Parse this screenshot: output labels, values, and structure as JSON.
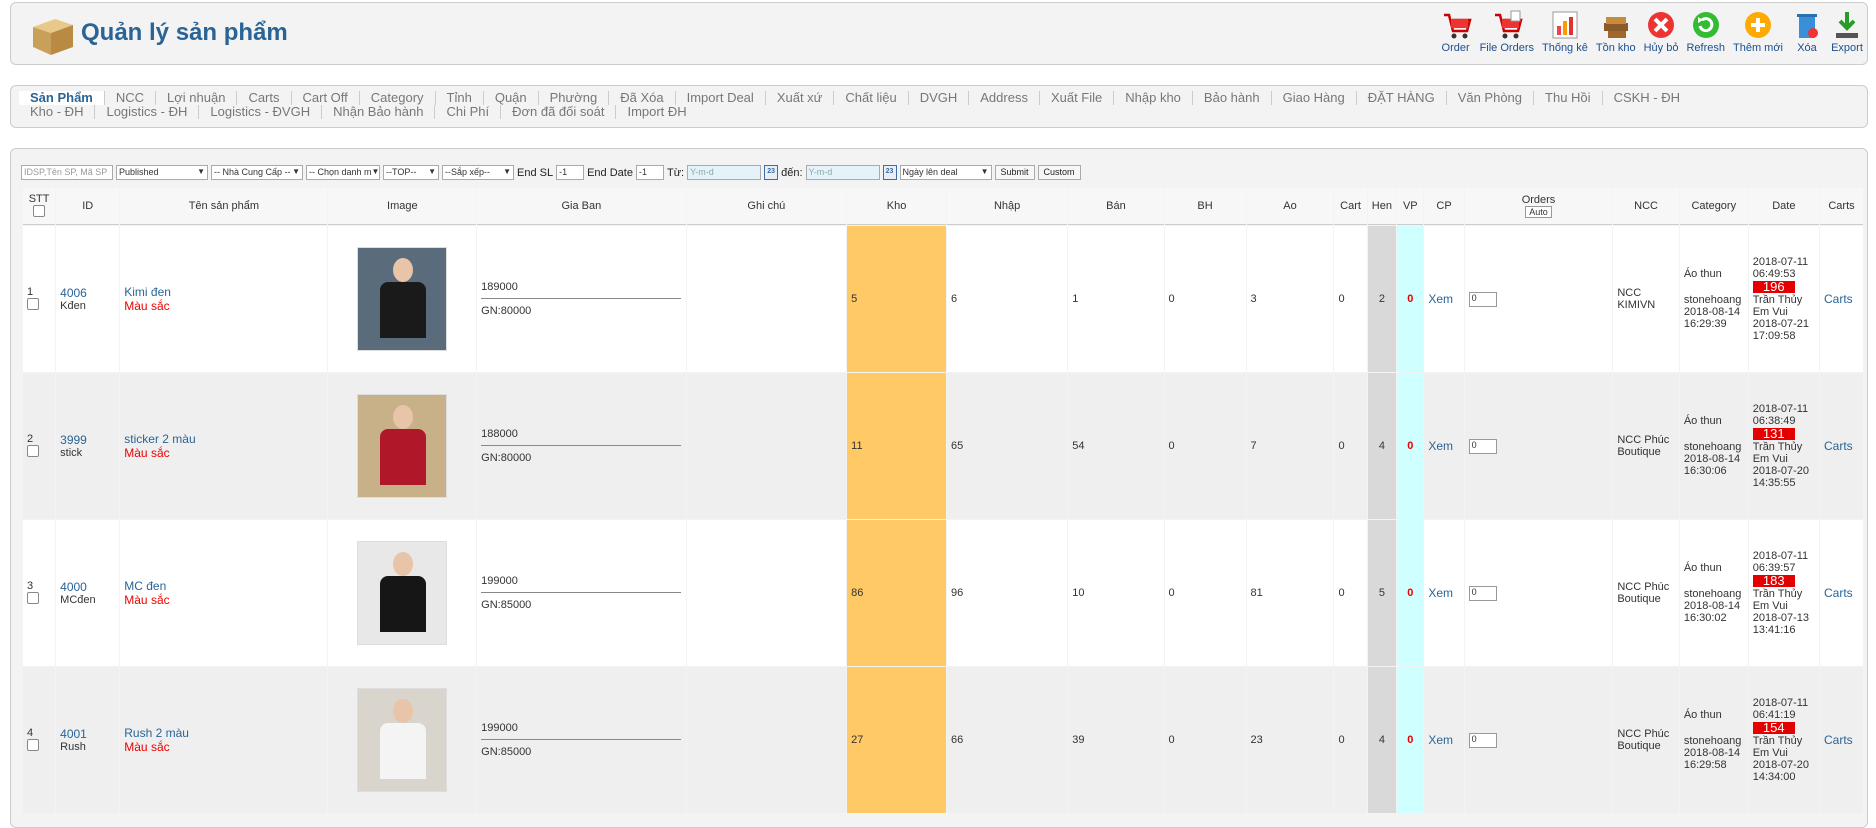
{
  "header": {
    "title": "Quản lý sản phẩm"
  },
  "toolbar": [
    {
      "label": "Order",
      "icon": "cart-icon"
    },
    {
      "label": "File Orders",
      "icon": "cart-file-icon"
    },
    {
      "label": "Thống kê",
      "icon": "chart-icon"
    },
    {
      "label": "Tồn kho",
      "icon": "boxes-icon"
    },
    {
      "label": "Hủy bỏ",
      "icon": "cancel-icon"
    },
    {
      "label": "Refresh",
      "icon": "refresh-icon"
    },
    {
      "label": "Thêm mới",
      "icon": "add-icon"
    },
    {
      "label": "Xóa",
      "icon": "trash-icon"
    },
    {
      "label": "Export",
      "icon": "export-icon"
    }
  ],
  "nav": {
    "row1": [
      "Sản Phẩm",
      "NCC",
      "Lợi nhuận",
      "Carts",
      "Cart Off",
      "Category",
      "Tỉnh",
      "Quận",
      "Phường",
      "Đã Xóa",
      "Import Deal",
      "Xuất xứ",
      "Chất liệu",
      "DVGH",
      "Address",
      "Xuất File",
      "Nhập kho",
      "Bảo hành",
      "Giao Hàng",
      "ĐẶT HÀNG",
      "Văn Phòng",
      "Thu Hồi",
      "CSKH - ĐH"
    ],
    "row2": [
      "Kho - ĐH",
      "Logistics - ĐH",
      "Logistics - ĐVGH",
      "Nhận Bảo hành",
      "Chi Phí",
      "Đơn đã đối soát",
      "Import ĐH"
    ],
    "active": "Sản Phẩm"
  },
  "filters": {
    "search_placeholder": "IDSP,Tên SP, Mã SP",
    "status": "Published",
    "supplier": "-- Nhà Cung Cấp --",
    "category": "-- Chọn danh m",
    "top": "--TOP--",
    "sort": "--Sắp xếp--",
    "end_sl_label": "End SL",
    "end_sl_value": "-1",
    "end_date_label": "End Date",
    "end_date_value": "-1",
    "from_label": "Từ:",
    "from_placeholder": "Y-m-d",
    "to_label": "đến:",
    "to_placeholder": "Y-m-d",
    "calendar_label": "23",
    "date_type": "Ngày lên deal",
    "submit": "Submit",
    "custom": "Custom"
  },
  "columns": [
    "STT",
    "ID",
    "Tên sản phẩm",
    "Image",
    "Gia Ban",
    "Ghi chú",
    "Kho",
    "Nhập",
    "Bán",
    "BH",
    "Ao",
    "Cart",
    "Hen",
    "VP",
    "CP",
    "Orders",
    "NCC",
    "Category",
    "Date",
    "Carts"
  ],
  "orders_auto": "Auto",
  "rows": [
    {
      "stt": "1",
      "id": "4006",
      "code": "Kđen",
      "name": "Kimi đen",
      "color": "Màu sắc",
      "price": "189000",
      "gn": "GN:80000",
      "kho": "5",
      "nhap": "6",
      "ban": "1",
      "bh": "0",
      "ao": "3",
      "cart": "0",
      "hen": "2",
      "vp": "0",
      "cp": "Xem",
      "orders": "0",
      "ncc": "NCC KIMIVN",
      "cat": "Áo thun",
      "user": "stonehoang",
      "updated": "2018-08-14 16:29:39",
      "date1": "2018-07-11 06:49:53",
      "badge": "196",
      "person": "Trần Thủy Em Vui",
      "date2": "2018-07-21 17:09:58",
      "carts": "Carts",
      "img_bg": "#5a6b7c",
      "img_fg": "#1a1a1a"
    },
    {
      "stt": "2",
      "id": "3999",
      "code": "stick",
      "name": "sticker 2 màu",
      "color": "Màu sắc",
      "price": "188000",
      "gn": "GN:80000",
      "kho": "11",
      "nhap": "65",
      "ban": "54",
      "bh": "0",
      "ao": "7",
      "cart": "0",
      "hen": "4",
      "vp": "0",
      "cp": "Xem",
      "orders": "0",
      "ncc": "NCC Phúc Boutique",
      "cat": "Áo thun",
      "user": "stonehoang",
      "updated": "2018-08-14 16:30:06",
      "date1": "2018-07-11 06:38:49",
      "badge": "131",
      "person": "Trần Thủy Em Vui",
      "date2": "2018-07-20 14:35:55",
      "carts": "Carts",
      "img_bg": "#c8b089",
      "img_fg": "#b0182a"
    },
    {
      "stt": "3",
      "id": "4000",
      "code": "MCđen",
      "name": "MC đen",
      "color": "Màu sắc",
      "price": "199000",
      "gn": "GN:85000",
      "kho": "86",
      "nhap": "96",
      "ban": "10",
      "bh": "0",
      "ao": "81",
      "cart": "0",
      "hen": "5",
      "vp": "0",
      "cp": "Xem",
      "orders": "0",
      "ncc": "NCC Phúc Boutique",
      "cat": "Áo thun",
      "user": "stonehoang",
      "updated": "2018-08-14 16:30:02",
      "date1": "2018-07-11 06:39:57",
      "badge": "183",
      "person": "Trần Thủy Em Vui",
      "date2": "2018-07-13 13:41:16",
      "carts": "Carts",
      "img_bg": "#e8e8e8",
      "img_fg": "#161616"
    },
    {
      "stt": "4",
      "id": "4001",
      "code": "Rush",
      "name": "Rush 2 màu",
      "color": "Màu sắc",
      "price": "199000",
      "gn": "GN:85000",
      "kho": "27",
      "nhap": "66",
      "ban": "39",
      "bh": "0",
      "ao": "23",
      "cart": "0",
      "hen": "4",
      "vp": "0",
      "cp": "Xem",
      "orders": "0",
      "ncc": "NCC Phúc Boutique",
      "cat": "Áo thun",
      "user": "stonehoang",
      "updated": "2018-08-14 16:29:58",
      "date1": "2018-07-11 06:41:19",
      "badge": "154",
      "person": "Trần Thủy Em Vui",
      "date2": "2018-07-20 14:34:00",
      "carts": "Carts",
      "img_bg": "#d9d4cc",
      "img_fg": "#f4f4f4"
    }
  ]
}
